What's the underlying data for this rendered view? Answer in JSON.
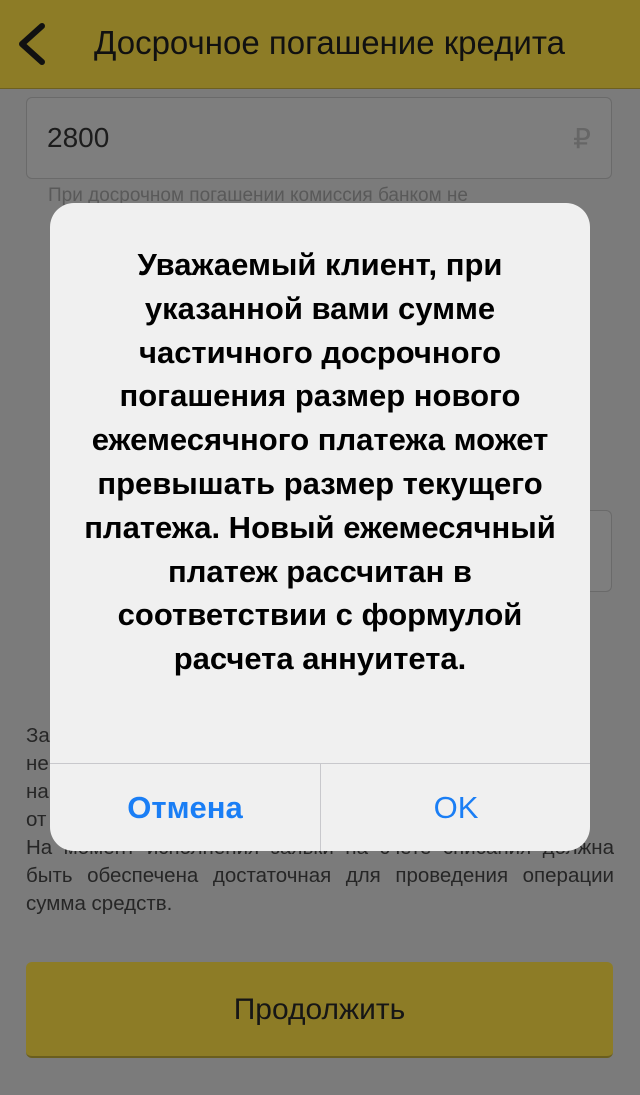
{
  "header": {
    "title": "Досрочное погашение кредита",
    "back_icon": "chevron-left-icon"
  },
  "form": {
    "amount_value": "2800",
    "currency": "₽",
    "hint": "При досрочном погашении комиссия банком не"
  },
  "note": {
    "text": "За\nне\nна\nот\nНа момент исполнения заявки на счете списания должна быть обеспечена достаточная для проведения операции сумма средств."
  },
  "continue_button": {
    "label": "Продолжить"
  },
  "dialog": {
    "message": "Уважаемый клиент, при указанной вами сумме частичного досрочного погашения размер нового ежемесячного платежа может превышать размер текущего платежа. Новый ежемесячный платеж рассчитан в соответствии с формулой расчета аннуитета.",
    "cancel_label": "Отмена",
    "ok_label": "OK"
  },
  "colors": {
    "header_bg": "#8d7c26",
    "overlay_bg": "#7b7b7b",
    "dialog_bg": "#f0f0f0",
    "dialog_button_text": "#1a7ef5"
  }
}
